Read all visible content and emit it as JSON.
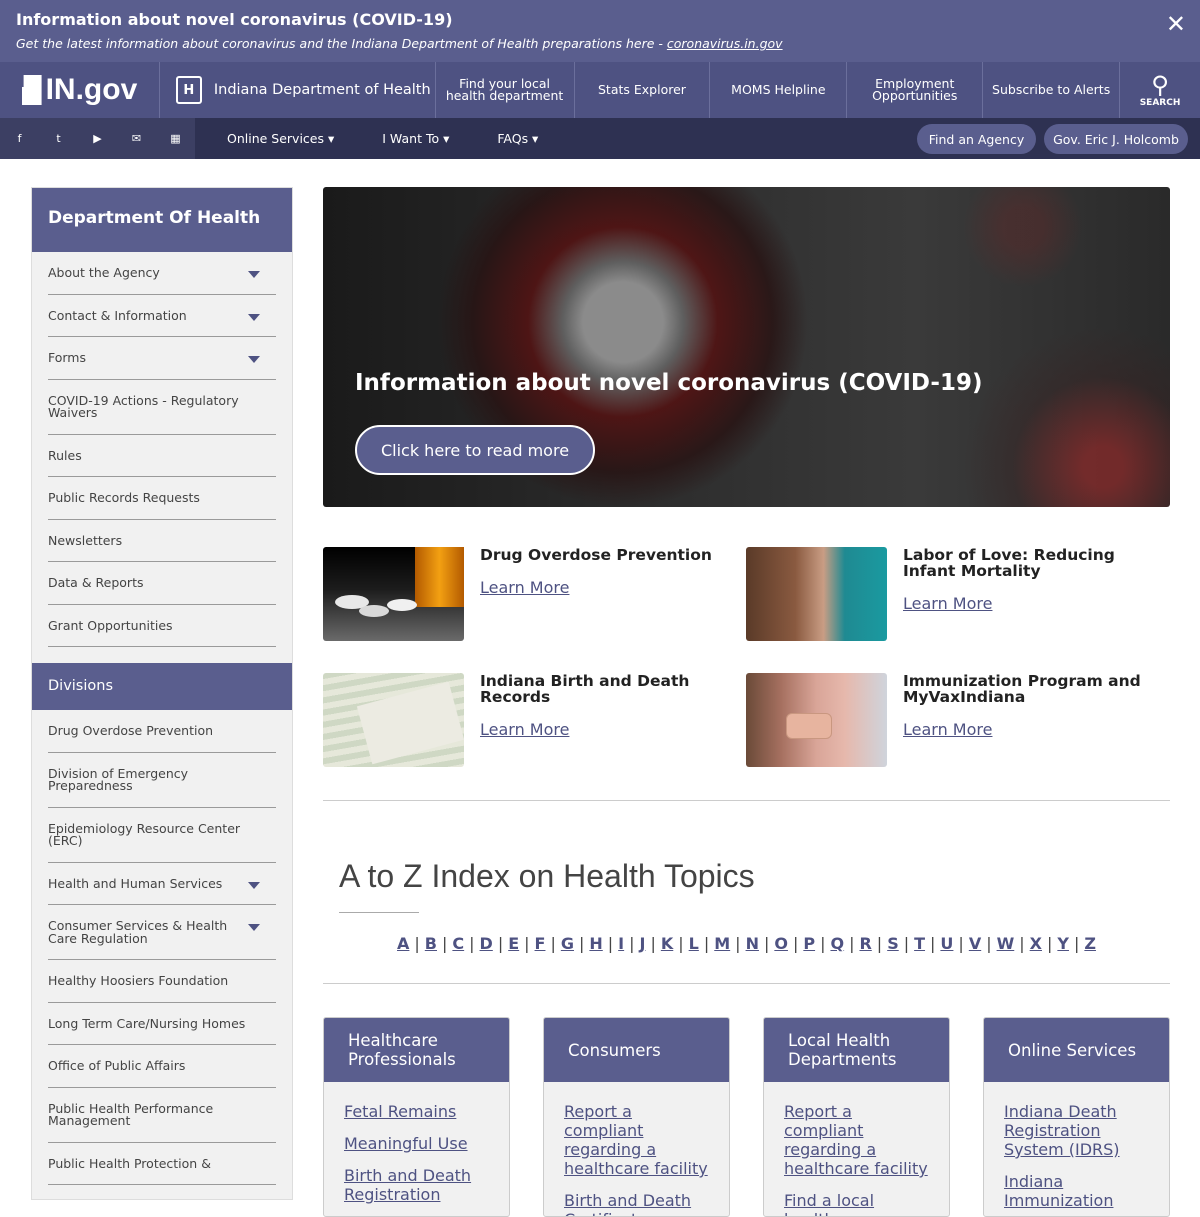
{
  "alert": {
    "title": "Information about novel coronavirus (COVID-19)",
    "subtitle": "Get the latest information about coronavirus and the Indiana Department of Health preparations here - ",
    "link": "coronavirus.in.gov",
    "close": "✕"
  },
  "nav": {
    "logo": "IN.gov",
    "dept_icon": "H",
    "dept": "Indiana Department of Health",
    "items": [
      "Find your local health department",
      "Stats Explorer",
      "MOMS Helpline",
      "Employment Opportunities",
      "Subscribe to Alerts"
    ],
    "search": "SEARCH",
    "search_glyph": "⚲"
  },
  "subnav": {
    "social": [
      "f",
      "t",
      "▶",
      "✉",
      "▦"
    ],
    "menus": [
      "Online Services ▾",
      "I Want To ▾",
      "FAQs ▾"
    ],
    "find_agency": "Find an Agency",
    "governor": "Gov. Eric J. Holcomb"
  },
  "sidebar": {
    "title": "Department Of Health",
    "items": [
      {
        "label": "About the Agency",
        "expand": true
      },
      {
        "label": "Contact & Information",
        "expand": true
      },
      {
        "label": "Forms",
        "expand": true
      },
      {
        "label": "COVID-19 Actions - Regulatory Waivers",
        "expand": false
      },
      {
        "label": "Rules",
        "expand": false
      },
      {
        "label": "Public Records Requests",
        "expand": false
      },
      {
        "label": "Newsletters",
        "expand": false
      },
      {
        "label": "Data & Reports",
        "expand": false
      },
      {
        "label": "Grant Opportunities",
        "expand": false
      }
    ],
    "divisions_title": "Divisions",
    "divisions": [
      {
        "label": "Drug Overdose Prevention",
        "expand": false
      },
      {
        "label": "Division of Emergency Preparedness",
        "expand": false
      },
      {
        "label": "Epidemiology Resource Center (ERC)",
        "expand": false
      },
      {
        "label": "Health and Human Services",
        "expand": true
      },
      {
        "label": "Consumer Services & Health Care Regulation",
        "expand": true
      },
      {
        "label": "Healthy Hoosiers Foundation",
        "expand": false
      },
      {
        "label": "Long Term Care/Nursing Homes",
        "expand": false
      },
      {
        "label": "Office of Public Affairs",
        "expand": false
      },
      {
        "label": "Public Health Performance Management",
        "expand": false
      },
      {
        "label": "Public Health Protection &",
        "expand": false
      }
    ]
  },
  "hero": {
    "title": "Information about novel coronavirus (COVID-19)",
    "button": "Click here to read more"
  },
  "features": [
    {
      "title": "Drug Overdose Prevention",
      "link": "Learn More"
    },
    {
      "title": "Labor of Love: Reducing Infant Mortality",
      "link": "Learn More"
    },
    {
      "title": "Indiana Birth and Death Records",
      "link": "Learn More"
    },
    {
      "title": "Immunization Program and MyVaxIndiana",
      "link": "Learn More"
    }
  ],
  "az": {
    "title": "A to Z Index on Health Topics",
    "letters": [
      "A",
      "B",
      "C",
      "D",
      "E",
      "F",
      "G",
      "H",
      "I",
      "J",
      "K",
      "L",
      "M",
      "N",
      "O",
      "P",
      "Q",
      "R",
      "S",
      "T",
      "U",
      "V",
      "W",
      "X",
      "Y",
      "Z"
    ]
  },
  "categories": [
    {
      "title": "Healthcare Professionals",
      "links": [
        "Fetal Remains",
        "Meaningful Use",
        "Birth and Death Registration"
      ]
    },
    {
      "title": "Consumers",
      "links": [
        "Report a compliant regarding a healthcare facility",
        "Birth and Death Certificates"
      ]
    },
    {
      "title": "Local Health Departments",
      "links": [
        "Report a compliant regarding a healthcare facility",
        "Find a local health department"
      ]
    },
    {
      "title": "Online Services",
      "links": [
        "Indiana Death Registration System (IDRS)",
        "Indiana Immunization"
      ]
    }
  ]
}
